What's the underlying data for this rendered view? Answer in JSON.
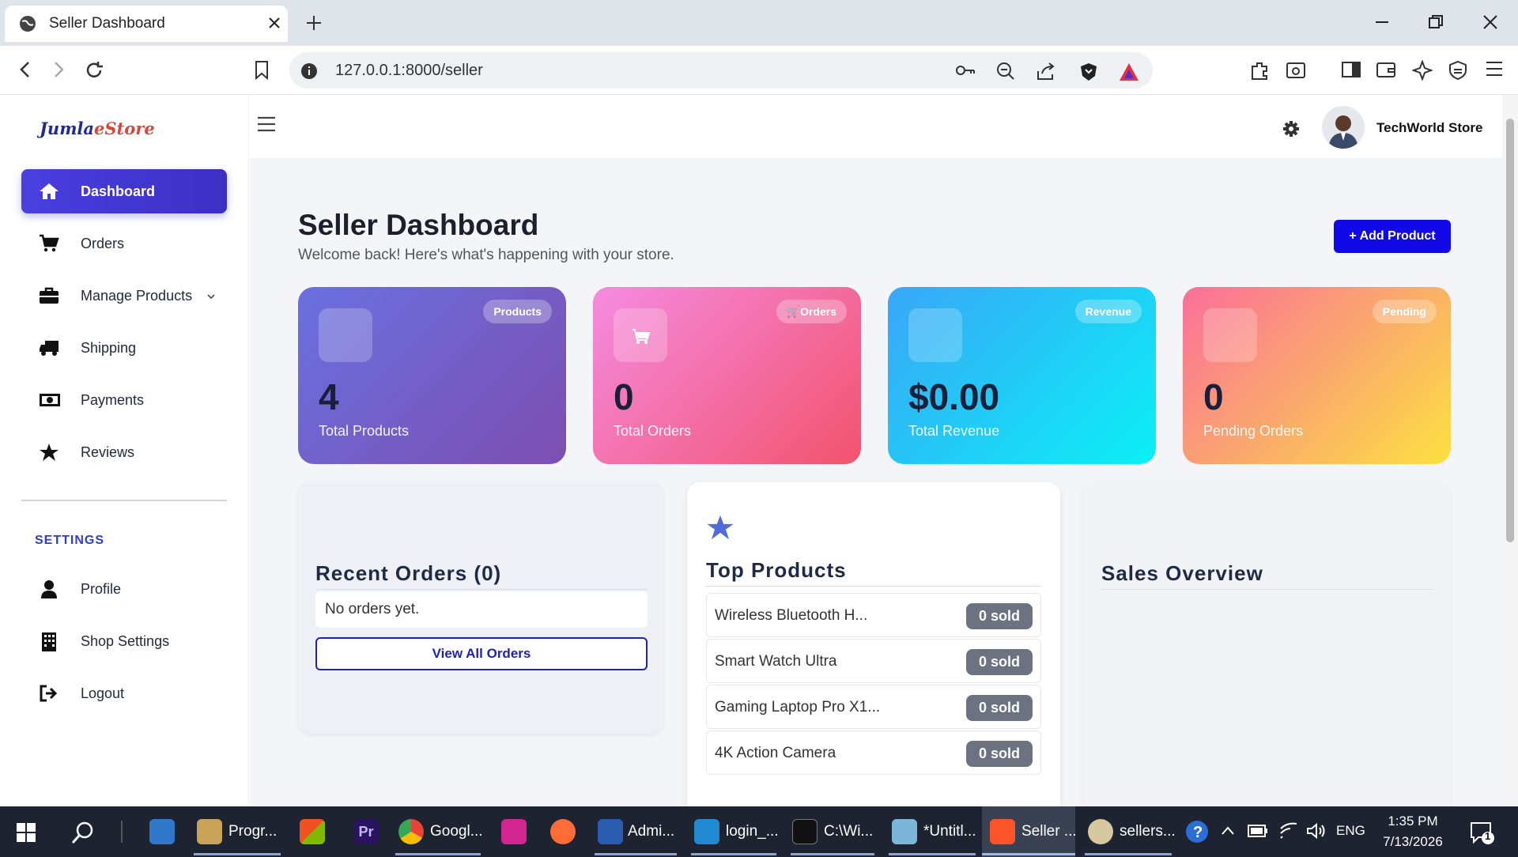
{
  "browser": {
    "tab_title": "Seller Dashboard",
    "url": "127.0.0.1:8000/seller"
  },
  "sidebar": {
    "logo_part1": "Jumla",
    "logo_part2": "eStore",
    "items": [
      {
        "label": "Dashboard",
        "icon": "home-icon"
      },
      {
        "label": "Orders",
        "icon": "cart-icon"
      },
      {
        "label": "Manage Products",
        "icon": "briefcase-icon"
      },
      {
        "label": "Shipping",
        "icon": "truck-icon"
      },
      {
        "label": "Payments",
        "icon": "money-icon"
      },
      {
        "label": "Reviews",
        "icon": "star-icon"
      }
    ],
    "settings_heading": "SETTINGS",
    "settings_items": [
      {
        "label": "Profile",
        "icon": "user-icon"
      },
      {
        "label": "Shop Settings",
        "icon": "building-icon"
      },
      {
        "label": "Logout",
        "icon": "logout-icon"
      }
    ]
  },
  "header": {
    "store_name": "TechWorld Store"
  },
  "page": {
    "title": "Seller Dashboard",
    "subtitle": "Welcome back! Here's what's happening with your store.",
    "add_button": "Add Product"
  },
  "stats": [
    {
      "badge": "Products",
      "value": "4",
      "label": "Total Products"
    },
    {
      "badge": "Orders",
      "value": "0",
      "label": "Total Orders"
    },
    {
      "badge": "Revenue",
      "value": "$0.00",
      "label": "Total Revenue"
    },
    {
      "badge": "Pending",
      "value": "0",
      "label": "Pending Orders"
    }
  ],
  "recent_orders": {
    "title": "Recent Orders (0)",
    "empty_text": "No orders yet.",
    "button": "View All Orders"
  },
  "top_products": {
    "title": "Top Products",
    "items": [
      {
        "name": "Wireless Bluetooth H...",
        "sold": "0 sold"
      },
      {
        "name": "Smart Watch Ultra",
        "sold": "0 sold"
      },
      {
        "name": "Gaming Laptop Pro X1...",
        "sold": "0 sold"
      },
      {
        "name": "4K Action Camera",
        "sold": "0 sold"
      }
    ]
  },
  "sales_overview": {
    "title": "Sales Overview"
  },
  "taskbar": {
    "items": [
      {
        "label": "Progr..."
      },
      {
        "label": "Googl..."
      },
      {
        "label": "Admi..."
      },
      {
        "label": "login_..."
      },
      {
        "label": "C:\\Wi..."
      },
      {
        "label": "*Untitl..."
      },
      {
        "label": "Seller ..."
      },
      {
        "label": "sellers..."
      }
    ],
    "lang": "ENG",
    "time": "1:35 PM",
    "date": "7/13/2026",
    "notification_count": "1"
  },
  "colors": {
    "accent": "#4a3fe0",
    "add_button": "#1209e8",
    "settings_heading": "#2b3ed1"
  }
}
